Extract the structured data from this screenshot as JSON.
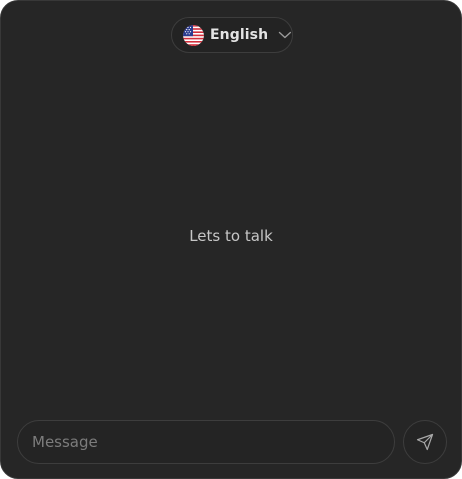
{
  "language_selector": {
    "label": "English",
    "flag_icon": "us-flag-icon",
    "dropdown_icon": "chevron-down-icon"
  },
  "chat": {
    "empty_message": "Lets to talk"
  },
  "composer": {
    "placeholder": "Message",
    "value": "",
    "send_icon": "send-icon"
  },
  "colors": {
    "panel_background": "#262626",
    "border": "#3d3d3d",
    "text": "#c6c6c6",
    "placeholder": "#7c7c7c"
  }
}
